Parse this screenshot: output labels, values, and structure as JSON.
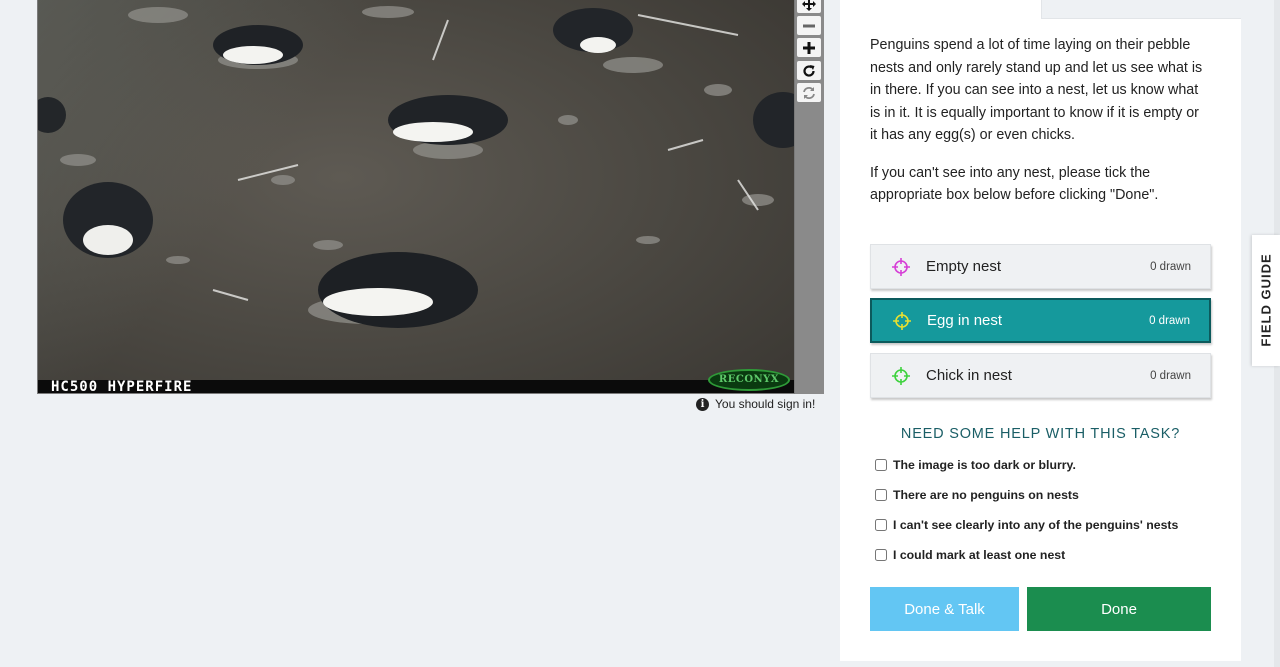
{
  "subject": {
    "camera_label": "HC500 HYPERFIRE",
    "brand_logo": "RECONYX",
    "sign_in_notice": "You should sign in!"
  },
  "toolbar": {
    "tools": [
      "move-icon",
      "zoom-out-icon",
      "zoom-in-icon",
      "rotate-icon",
      "reset-icon"
    ]
  },
  "task": {
    "instructions_p1": "Penguins spend a lot of time laying on their pebble nests and only rarely stand up and let us see what is in there. If you can see into a nest, let us know what is in it. It is equally important to know if it is empty or it has any egg(s) or even chicks.",
    "instructions_p2": "If you can't see into any nest, please tick the appropriate box below before clicking \"Done\".",
    "tools": [
      {
        "label": "Empty nest",
        "count": "0 drawn",
        "color": "#d63fd6",
        "active": false
      },
      {
        "label": "Egg in nest",
        "count": "0 drawn",
        "color": "#e8e030",
        "active": true
      },
      {
        "label": "Chick in nest",
        "count": "0 drawn",
        "color": "#3ed23e",
        "active": false
      }
    ],
    "help_heading": "NEED SOME HELP WITH THIS TASK?",
    "checkboxes": [
      "The image is too dark or blurry.",
      "There are no penguins on nests",
      "I can't see clearly into any of the penguins' nests",
      "I could mark at least one nest"
    ],
    "done_talk_label": "Done & Talk",
    "done_label": "Done"
  },
  "field_guide_label": "FIELD GUIDE",
  "colors": {
    "active_tool": "#15999c",
    "done_button": "#1b8d4f",
    "done_talk_button": "#63c6f3",
    "help_heading": "#1a5e66",
    "page_background": "#eef1f4"
  }
}
